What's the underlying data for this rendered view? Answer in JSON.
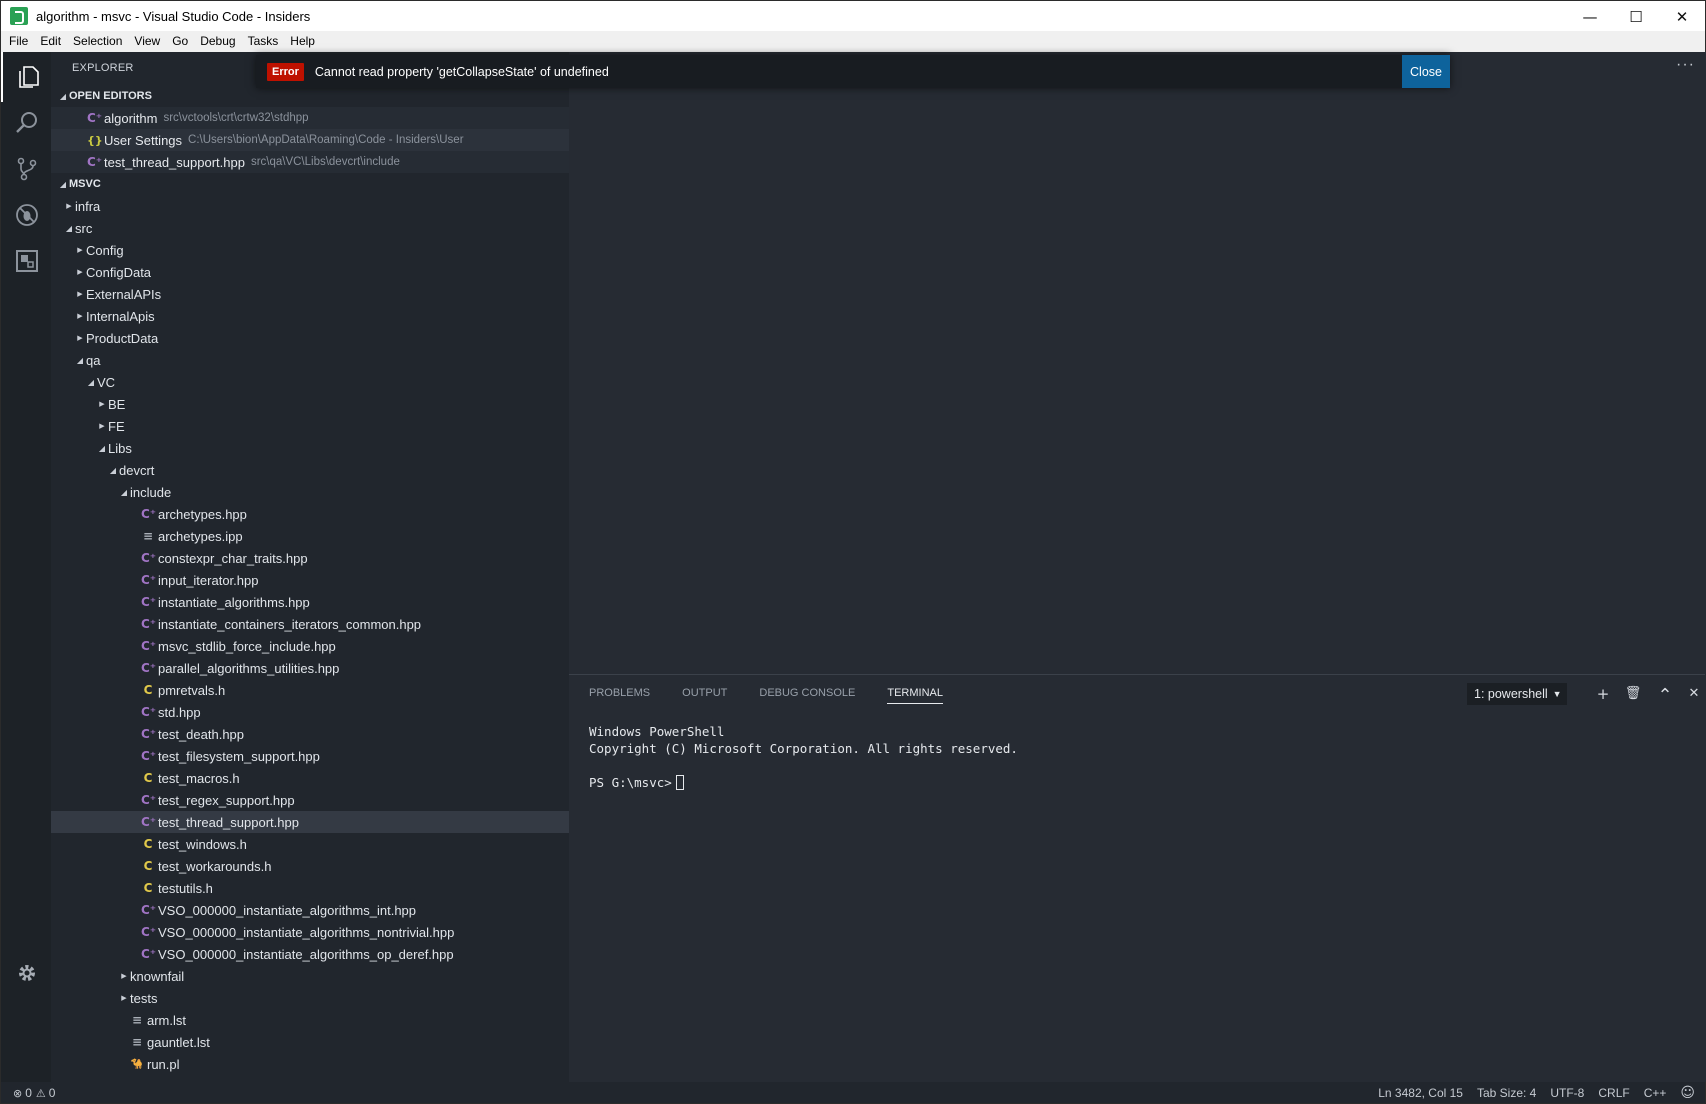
{
  "window": {
    "title": "algorithm - msvc - Visual Studio Code - Insiders",
    "controls": {
      "minimize": "—",
      "maximize": "☐",
      "close": "✕"
    }
  },
  "menu": [
    "File",
    "Edit",
    "Selection",
    "View",
    "Go",
    "Debug",
    "Tasks",
    "Help"
  ],
  "activity_bar": [
    "explorer-icon",
    "search-icon",
    "source-control-icon",
    "debug-icon",
    "extensions-icon",
    "settings-gear-icon"
  ],
  "sidebar": {
    "title": "Explorer",
    "open_editors_header": "Open Editors",
    "open_editors": [
      {
        "name": "algorithm",
        "path": "src\\vctools\\crt\\crtw32\\stdhpp",
        "icon": "cpp"
      },
      {
        "name": "User Settings",
        "path": "C:\\Users\\bion\\AppData\\Roaming\\Code - Insiders\\User",
        "icon": "json"
      },
      {
        "name": "test_thread_support.hpp",
        "path": "src\\qa\\VC\\Libs\\devcrt\\include",
        "icon": "cpp"
      }
    ],
    "workspace_header": "MSVC",
    "tree": [
      {
        "label": "infra",
        "depth": 0,
        "kind": "folder",
        "expanded": false
      },
      {
        "label": "src",
        "depth": 0,
        "kind": "folder",
        "expanded": true
      },
      {
        "label": "Config",
        "depth": 1,
        "kind": "folder",
        "expanded": false
      },
      {
        "label": "ConfigData",
        "depth": 1,
        "kind": "folder",
        "expanded": false
      },
      {
        "label": "ExternalAPIs",
        "depth": 1,
        "kind": "folder",
        "expanded": false
      },
      {
        "label": "InternalApis",
        "depth": 1,
        "kind": "folder",
        "expanded": false
      },
      {
        "label": "ProductData",
        "depth": 1,
        "kind": "folder",
        "expanded": false
      },
      {
        "label": "qa",
        "depth": 1,
        "kind": "folder",
        "expanded": true
      },
      {
        "label": "VC",
        "depth": 2,
        "kind": "folder",
        "expanded": true
      },
      {
        "label": "BE",
        "depth": 3,
        "kind": "folder",
        "expanded": false
      },
      {
        "label": "FE",
        "depth": 3,
        "kind": "folder",
        "expanded": false
      },
      {
        "label": "Libs",
        "depth": 3,
        "kind": "folder",
        "expanded": true
      },
      {
        "label": "devcrt",
        "depth": 4,
        "kind": "folder",
        "expanded": true
      },
      {
        "label": "include",
        "depth": 5,
        "kind": "folder",
        "expanded": true
      },
      {
        "label": "archetypes.hpp",
        "depth": 6,
        "kind": "cpp"
      },
      {
        "label": "archetypes.ipp",
        "depth": 6,
        "kind": "text"
      },
      {
        "label": "constexpr_char_traits.hpp",
        "depth": 6,
        "kind": "cpp"
      },
      {
        "label": "input_iterator.hpp",
        "depth": 6,
        "kind": "cpp"
      },
      {
        "label": "instantiate_algorithms.hpp",
        "depth": 6,
        "kind": "cpp"
      },
      {
        "label": "instantiate_containers_iterators_common.hpp",
        "depth": 6,
        "kind": "cpp"
      },
      {
        "label": "msvc_stdlib_force_include.hpp",
        "depth": 6,
        "kind": "cpp"
      },
      {
        "label": "parallel_algorithms_utilities.hpp",
        "depth": 6,
        "kind": "cpp"
      },
      {
        "label": "pmretvals.h",
        "depth": 6,
        "kind": "c"
      },
      {
        "label": "std.hpp",
        "depth": 6,
        "kind": "cpp"
      },
      {
        "label": "test_death.hpp",
        "depth": 6,
        "kind": "cpp"
      },
      {
        "label": "test_filesystem_support.hpp",
        "depth": 6,
        "kind": "cpp"
      },
      {
        "label": "test_macros.h",
        "depth": 6,
        "kind": "c"
      },
      {
        "label": "test_regex_support.hpp",
        "depth": 6,
        "kind": "cpp"
      },
      {
        "label": "test_thread_support.hpp",
        "depth": 6,
        "kind": "cpp",
        "selected": true
      },
      {
        "label": "test_windows.h",
        "depth": 6,
        "kind": "c"
      },
      {
        "label": "test_workarounds.h",
        "depth": 6,
        "kind": "c"
      },
      {
        "label": "testutils.h",
        "depth": 6,
        "kind": "c"
      },
      {
        "label": "VSO_000000_instantiate_algorithms_int.hpp",
        "depth": 6,
        "kind": "cpp"
      },
      {
        "label": "VSO_000000_instantiate_algorithms_nontrivial.hpp",
        "depth": 6,
        "kind": "cpp"
      },
      {
        "label": "VSO_000000_instantiate_algorithms_op_deref.hpp",
        "depth": 6,
        "kind": "cpp"
      },
      {
        "label": "knownfail",
        "depth": 5,
        "kind": "folder",
        "expanded": false
      },
      {
        "label": "tests",
        "depth": 5,
        "kind": "folder",
        "expanded": false
      },
      {
        "label": "arm.lst",
        "depth": 5,
        "kind": "text"
      },
      {
        "label": "gauntlet.lst",
        "depth": 5,
        "kind": "text"
      },
      {
        "label": "run.pl",
        "depth": 5,
        "kind": "perl"
      }
    ]
  },
  "notification": {
    "severity": "Error",
    "message": "Cannot read property 'getCollapseState' of undefined",
    "action": "Close"
  },
  "editor": {
    "more_actions": "···"
  },
  "panel": {
    "tabs": [
      "Problems",
      "Output",
      "Debug Console",
      "Terminal"
    ],
    "active_tab": "Terminal",
    "terminal_select": "1: powershell",
    "actions": {
      "new": "+",
      "kill": "🗑",
      "maximize": "⌃",
      "close": "✕"
    },
    "terminal_lines": [
      "Windows PowerShell",
      "Copyright (C) Microsoft Corporation. All rights reserved.",
      "",
      "PS G:\\msvc>"
    ]
  },
  "status": {
    "errors": "0",
    "warnings": "0",
    "position": "Ln 3482, Col 15",
    "tab_size": "Tab Size: 4",
    "encoding": "UTF-8",
    "eol": "CRLF",
    "language": "C++",
    "feedback": "☺"
  },
  "colors": {
    "error_badge": "#be1100",
    "close_button": "#0e639c",
    "cpp_icon": "#a074c4",
    "c_icon": "#e0c84a"
  }
}
